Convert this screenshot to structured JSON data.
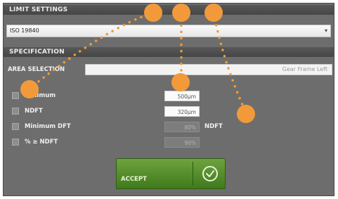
{
  "limit_settings": {
    "header": "LIMIT SETTINGS",
    "standard_value": "ISO 19840"
  },
  "specification": {
    "header": "SPECIFICATION",
    "area_selection_label": "AREA SELECTION",
    "area_selection_value": "Gear Frame Left",
    "rows": [
      {
        "label": "Minimum",
        "value": "500µm",
        "enabled": true,
        "unit": ""
      },
      {
        "label": "NDFT",
        "value": "320µm",
        "enabled": true,
        "unit": ""
      },
      {
        "label": "Minimum DFT",
        "value": "80%",
        "enabled": false,
        "unit": "NDFT"
      },
      {
        "label": "% ≥ NDFT",
        "value": "90%",
        "enabled": false,
        "unit": ""
      }
    ]
  },
  "accept_button": {
    "label": "ACCEPT",
    "icon": "clock-check-icon"
  },
  "colors": {
    "panel": "#6d6d6d",
    "header": "#4f4f4f",
    "accept_green": "#4f8a2a",
    "marker_orange": "#f29a3a"
  }
}
